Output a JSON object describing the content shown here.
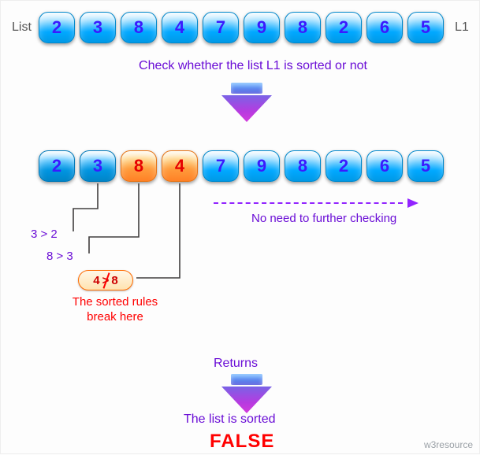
{
  "labels": {
    "list_left": "List",
    "list_right": "L1",
    "caption_check": "Check whether the list L1 is sorted or not",
    "no_need": "No need to further checking",
    "check1": "3 > 2",
    "check2": "8 > 3",
    "badge_left": "4",
    "badge_op": ">",
    "badge_right": "8",
    "break_rules": "The sorted rules break here",
    "returns": "Returns",
    "sorted_txt": "The list is sorted",
    "false_txt": "FALSE",
    "watermark": "w3resource"
  },
  "row1": [
    "2",
    "3",
    "8",
    "4",
    "7",
    "9",
    "8",
    "2",
    "6",
    "5"
  ],
  "row2": [
    {
      "v": "2",
      "style": "blue2"
    },
    {
      "v": "3",
      "style": "blue2"
    },
    {
      "v": "8",
      "style": "orange"
    },
    {
      "v": "4",
      "style": "orange"
    },
    {
      "v": "7",
      "style": "blue"
    },
    {
      "v": "9",
      "style": "blue"
    },
    {
      "v": "8",
      "style": "blue"
    },
    {
      "v": "2",
      "style": "blue"
    },
    {
      "v": "6",
      "style": "blue"
    },
    {
      "v": "5",
      "style": "blue"
    }
  ],
  "chart_data": {
    "type": "table",
    "title": "Check whether a list is sorted",
    "list_name": "L1",
    "list": [
      2,
      3,
      8,
      4,
      7,
      9,
      8,
      2,
      6,
      5
    ],
    "comparisons": [
      {
        "a": 3,
        "op": ">",
        "b": 2,
        "result": true
      },
      {
        "a": 8,
        "op": ">",
        "b": 3,
        "result": true
      },
      {
        "a": 4,
        "op": ">",
        "b": 8,
        "result": false
      }
    ],
    "break_index_pair": [
      2,
      3
    ],
    "early_stop_after_index": 3,
    "returns": false,
    "return_label": "The list is sorted",
    "return_value_label": "FALSE"
  }
}
